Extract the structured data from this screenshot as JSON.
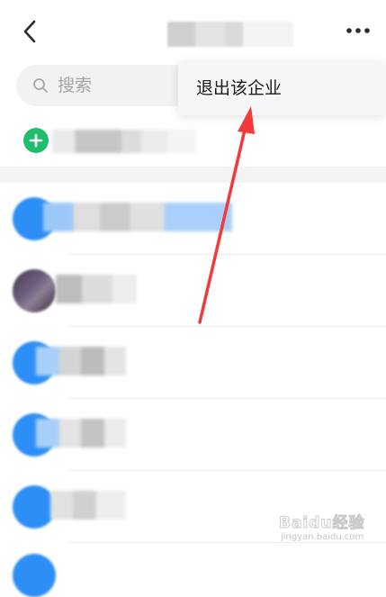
{
  "search": {
    "placeholder": "搜索"
  },
  "popup_menu": {
    "items": [
      {
        "label": "退出该企业"
      }
    ]
  },
  "watermark": {
    "text": "Baidu经验",
    "subtext": "jingyan.baidu.com"
  },
  "colors": {
    "accent_blue": "#2d8ff5",
    "add_green": "#1fbf6c",
    "arrow_red": "#f23a3a",
    "search_bg": "#f1f2f4",
    "menu_bg": "#f5f6f7"
  },
  "icons": {
    "back": "chevron-left-icon",
    "more": "more-dots-icon",
    "search": "search-icon",
    "add": "plus-circle-icon"
  }
}
